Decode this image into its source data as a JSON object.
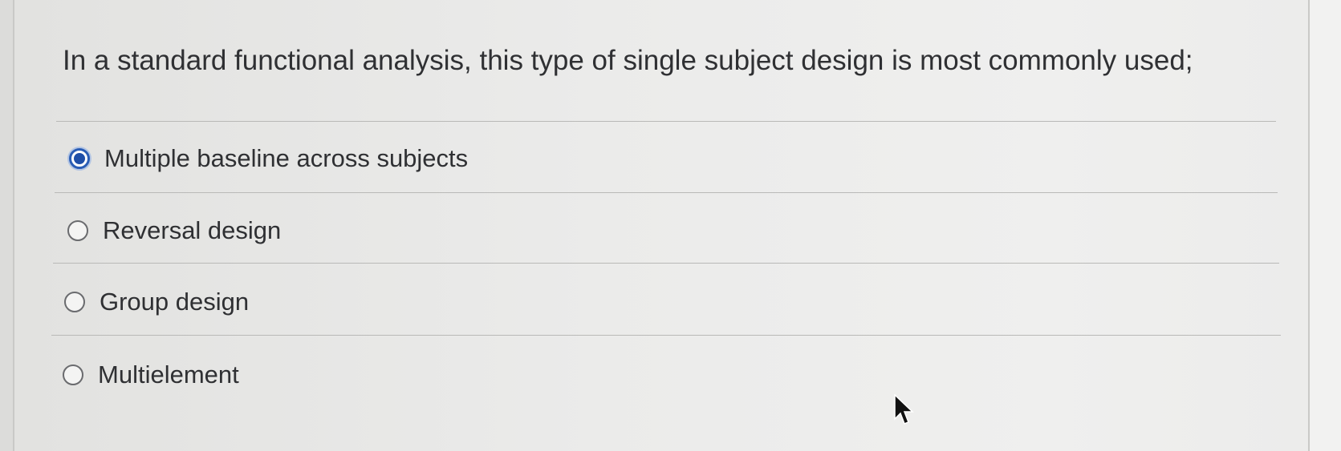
{
  "question": {
    "text": "In a standard functional analysis, this type of single subject design is most commonly used;"
  },
  "options": [
    {
      "label": "Multiple baseline across subjects",
      "selected": true
    },
    {
      "label": "Reversal design",
      "selected": false
    },
    {
      "label": "Group design",
      "selected": false
    },
    {
      "label": "Multielement",
      "selected": false
    }
  ],
  "colors": {
    "accent": "#1f4fa8",
    "text": "#2f3033",
    "divider": "#b9b9b7"
  },
  "icons": {
    "selected_radio": "radio-selected-icon",
    "unselected_radio": "radio-unselected-icon",
    "pointer": "mouse-cursor-icon"
  }
}
